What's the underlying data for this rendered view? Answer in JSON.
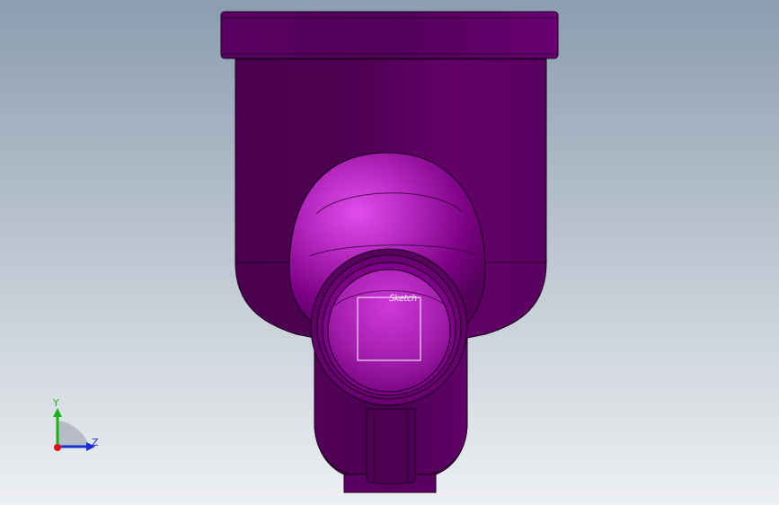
{
  "viewport": {
    "background_top": "#8b9db0",
    "background_bottom": "#eef0f2"
  },
  "model": {
    "body_color_dark": "#3e0042",
    "body_color_mid": "#66006c",
    "body_color_light": "#d23ddc",
    "edge_color": "#1a001c"
  },
  "sketch": {
    "label": "Sketch",
    "line_color": "#ffffff"
  },
  "triad": {
    "y_label": "Y",
    "z_label": "Z",
    "y_color": "#16b316",
    "z_color": "#1730d6",
    "origin_color": "#e01010",
    "plane_color": "#b8bcc4"
  }
}
